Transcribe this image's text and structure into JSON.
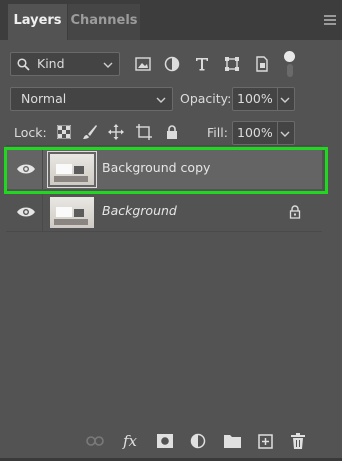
{
  "tabs": [
    {
      "label": "Layers",
      "active": true
    },
    {
      "label": "Channels",
      "active": false
    }
  ],
  "filter": {
    "selected": "Kind"
  },
  "blend": {
    "mode": "Normal",
    "opacity_label": "Opacity:",
    "opacity_value": "100%"
  },
  "lock": {
    "label": "Lock:",
    "fill_label": "Fill:",
    "fill_value": "100%"
  },
  "layers": [
    {
      "name": "Background copy",
      "selected": true,
      "visible": true,
      "locked": false
    },
    {
      "name": "Background",
      "selected": false,
      "visible": true,
      "locked": true
    }
  ],
  "bottom_icons": [
    "link-layers-icon",
    "fx-icon",
    "add-mask-icon",
    "adjustment-layer-icon",
    "group-folder-icon",
    "new-layer-icon",
    "delete-icon"
  ],
  "colors": {
    "panel": "#535353",
    "selected_row": "#646464",
    "highlight": "#1fd81f"
  }
}
